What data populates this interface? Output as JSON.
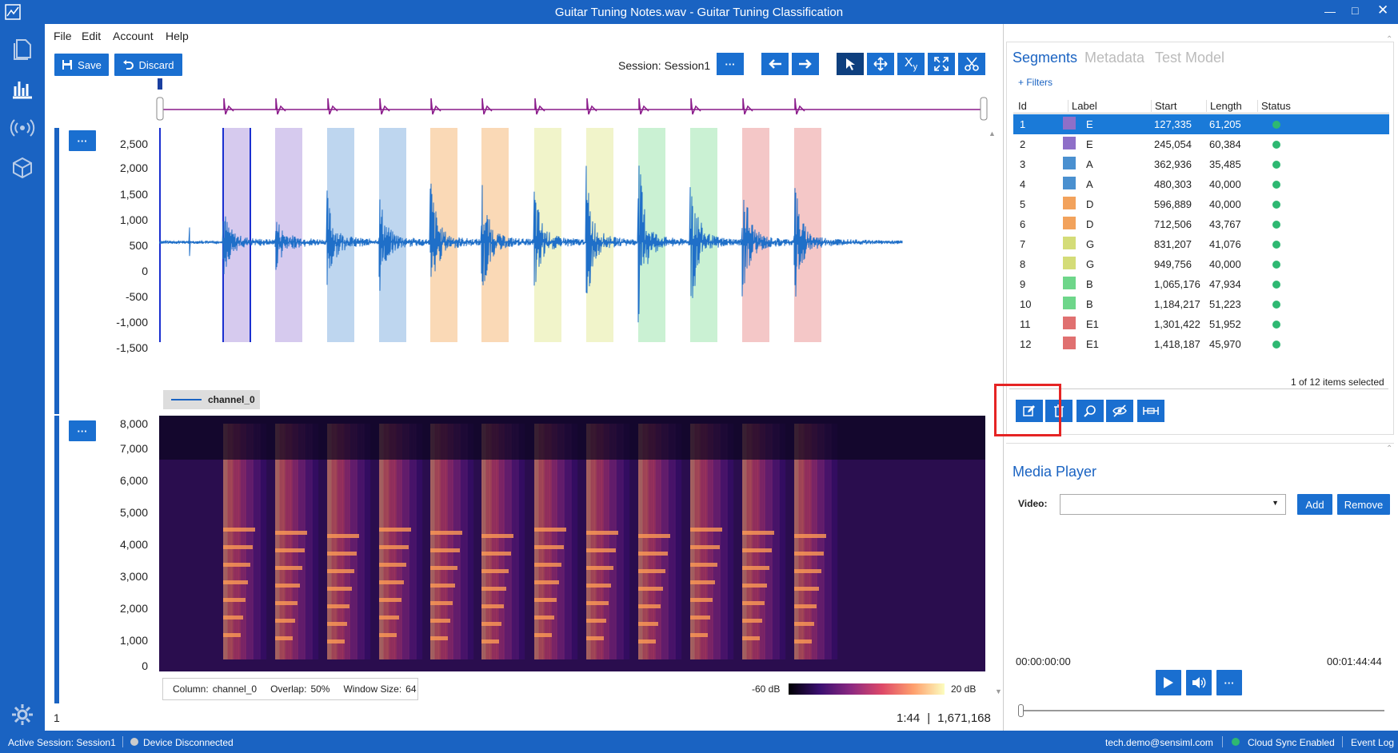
{
  "window": {
    "title": "Guitar Tuning Notes.wav - Guitar Tuning Classification"
  },
  "menu": {
    "file": "File",
    "edit": "Edit",
    "account": "Account",
    "help": "Help"
  },
  "toolbar": {
    "save": "Save",
    "discard": "Discard",
    "session_label": "Session:",
    "session_value": "Session1",
    "more": "···"
  },
  "waveform": {
    "yticks": [
      "2,500",
      "2,000",
      "1,500",
      "1,000",
      "500",
      "0",
      "-500",
      "-1,000",
      "-1,500"
    ],
    "legend": "channel_0"
  },
  "spectrogram": {
    "yticks": [
      "8,000",
      "7,000",
      "6,000",
      "5,000",
      "4,000",
      "3,000",
      "2,000",
      "1,000",
      "0"
    ],
    "column_label": "Column:",
    "column_value": "channel_0",
    "overlap_label": "Overlap:",
    "overlap_value": "50%",
    "window_label": "Window Size:",
    "window_value": "64",
    "db_min": "-60 dB",
    "db_max": "20 dB"
  },
  "footer": {
    "page": "1",
    "time": "1:44",
    "separator": "|",
    "samples": "1,671,168"
  },
  "panel": {
    "tabs": [
      "Segments",
      "Metadata",
      "Test Model"
    ],
    "filters": "+ Filters",
    "columns": [
      "Id",
      "Label",
      "Start",
      "Length",
      "Status"
    ],
    "selection": "1 of 12 items selected"
  },
  "segments": [
    {
      "id": "1",
      "label": "E",
      "start": "127,335",
      "length": "61,205",
      "color": "#8e6fc8"
    },
    {
      "id": "2",
      "label": "E",
      "start": "245,054",
      "length": "60,384",
      "color": "#8e6fc8"
    },
    {
      "id": "3",
      "label": "A",
      "start": "362,936",
      "length": "35,485",
      "color": "#4a90d0"
    },
    {
      "id": "4",
      "label": "A",
      "start": "480,303",
      "length": "40,000",
      "color": "#4a90d0"
    },
    {
      "id": "5",
      "label": "D",
      "start": "596,889",
      "length": "40,000",
      "color": "#f2a25c"
    },
    {
      "id": "6",
      "label": "D",
      "start": "712,506",
      "length": "43,767",
      "color": "#f2a25c"
    },
    {
      "id": "7",
      "label": "G",
      "start": "831,207",
      "length": "41,076",
      "color": "#d4dc78"
    },
    {
      "id": "8",
      "label": "G",
      "start": "949,756",
      "length": "40,000",
      "color": "#d4dc78"
    },
    {
      "id": "9",
      "label": "B",
      "start": "1,065,176",
      "length": "47,934",
      "color": "#6ed68a"
    },
    {
      "id": "10",
      "label": "B",
      "start": "1,184,217",
      "length": "51,223",
      "color": "#6ed68a"
    },
    {
      "id": "11",
      "label": "E1",
      "start": "1,301,422",
      "length": "51,952",
      "color": "#e07070"
    },
    {
      "id": "12",
      "label": "E1",
      "start": "1,418,187",
      "length": "45,970",
      "color": "#e07070"
    }
  ],
  "media": {
    "title": "Media Player",
    "video_label": "Video:",
    "add": "Add",
    "remove": "Remove",
    "time_start": "00:00:00:00",
    "time_end": "00:01:44:44"
  },
  "status": {
    "active_session": "Active Session:  Session1",
    "device": "Device Disconnected",
    "user": "tech.demo@sensiml.com",
    "cloud": "Cloud Sync Enabled",
    "event_log": "Event Log"
  },
  "colors": {
    "accent": "#1a63c2",
    "status_ok": "#2eb872"
  }
}
